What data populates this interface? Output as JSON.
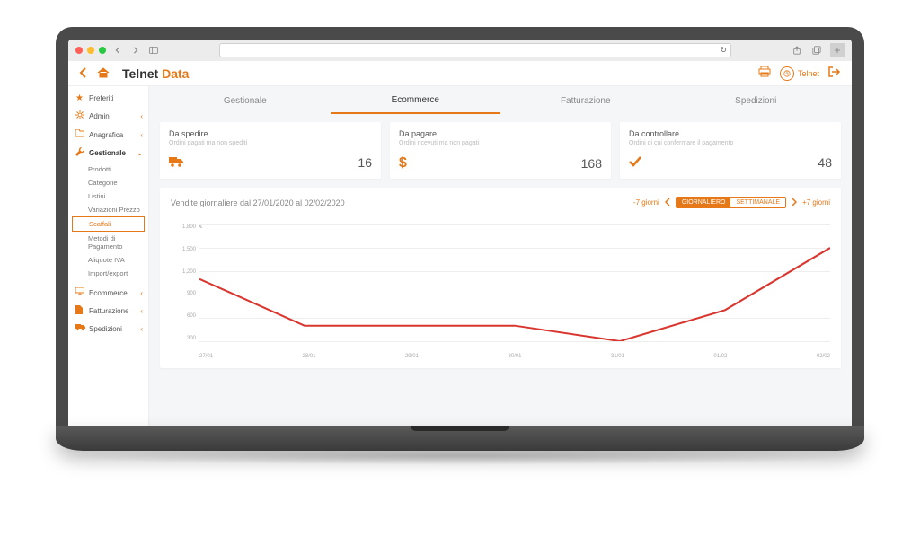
{
  "logo": {
    "part1": "Telnet ",
    "part2": "Data"
  },
  "topbar": {
    "user": "Telnet"
  },
  "sidebar": {
    "items": [
      {
        "icon": "star-icon",
        "label": "Preferiti"
      },
      {
        "icon": "gear-icon",
        "label": "Admin"
      },
      {
        "icon": "folder-icon",
        "label": "Anagrafica"
      },
      {
        "icon": "wrench-icon",
        "label": "Gestionale"
      }
    ],
    "sub": [
      "Prodotti",
      "Categorie",
      "Listini",
      "Variazioni Prezzo",
      "Scaffali",
      "Metodi di Pagamento",
      "Aliquote IVA",
      "Import/export"
    ],
    "bottom": [
      {
        "icon": "monitor-icon",
        "label": "Ecommerce"
      },
      {
        "icon": "file-icon",
        "label": "Fatturazione"
      },
      {
        "icon": "truck-icon",
        "label": "Spedizioni"
      }
    ]
  },
  "tabs": [
    "Gestionale",
    "Ecommerce",
    "Fatturazione",
    "Spedizioni"
  ],
  "cards": [
    {
      "title": "Da spedire",
      "sub": "Ordini pagati ma non spediti",
      "value": "16"
    },
    {
      "title": "Da pagare",
      "sub": "Ordini ricevuti ma non pagati",
      "value": "168"
    },
    {
      "title": "Da controllare",
      "sub": "Ordini di cui confermare il pagamento",
      "value": "48"
    }
  ],
  "chart": {
    "title": "Vendite giornaliere dal 27/01/2020 al 02/02/2020",
    "prev": "-7 giorni",
    "next": "+7 giorni",
    "toggle_on": "GIORNALIERO",
    "toggle_off": "SETTIMANALE",
    "y_ticks": [
      "1,800",
      "1,500",
      "1,200",
      "900",
      "600",
      "300"
    ],
    "unit": "€",
    "x_ticks": [
      "27/01",
      "28/01",
      "29/01",
      "30/01",
      "31/01",
      "01/02",
      "02/02"
    ]
  },
  "chart_data": {
    "type": "line",
    "title": "Vendite giornaliere dal 27/01/2020 al 02/02/2020",
    "xlabel": "",
    "ylabel": "€",
    "ylim": [
      300,
      1800
    ],
    "categories": [
      "27/01",
      "28/01",
      "29/01",
      "30/01",
      "31/01",
      "01/02",
      "02/02"
    ],
    "values": [
      1100,
      500,
      500,
      500,
      300,
      700,
      1500
    ]
  }
}
